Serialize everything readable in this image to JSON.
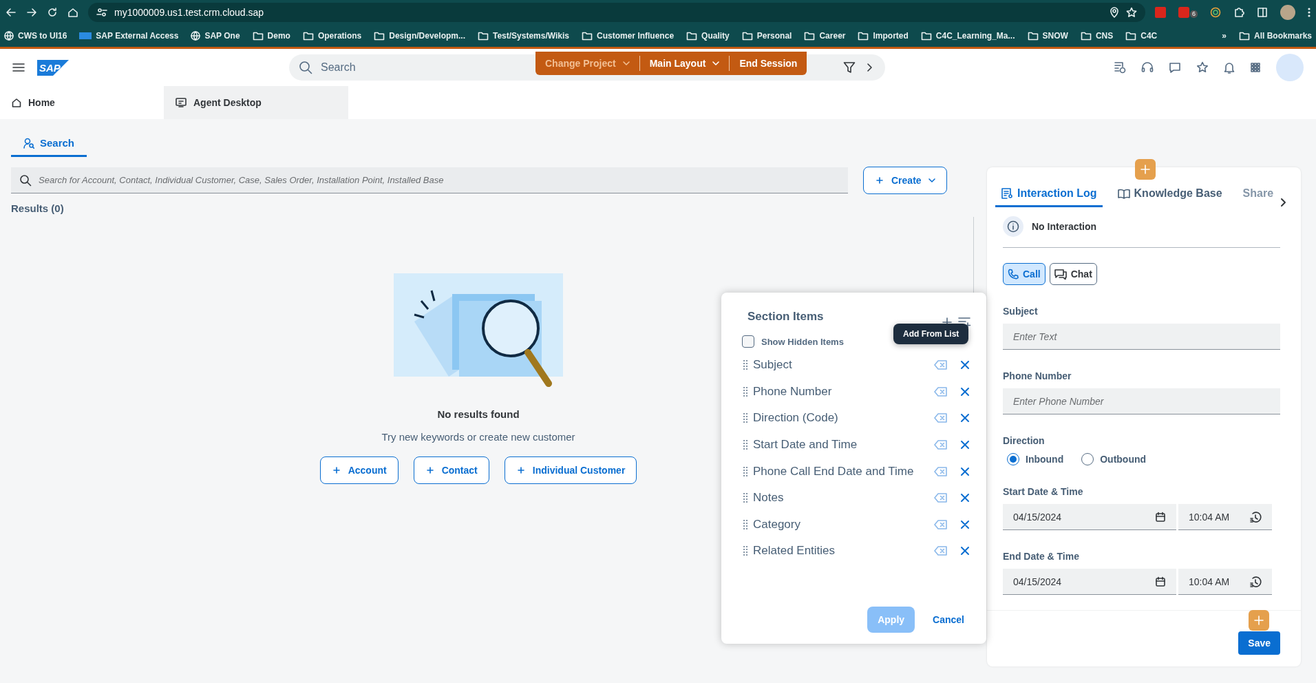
{
  "browser": {
    "url": "my1000009.us1.test.crm.cloud.sap",
    "extension_badge": "6",
    "bookmarks": [
      {
        "label": "CWS to UI16",
        "kind": "site"
      },
      {
        "label": "SAP External Access",
        "kind": "sap"
      },
      {
        "label": "SAP One",
        "kind": "site"
      },
      {
        "label": "Demo",
        "kind": "folder"
      },
      {
        "label": "Operations",
        "kind": "folder"
      },
      {
        "label": "Design/Developm...",
        "kind": "folder"
      },
      {
        "label": "Test/Systems/Wikis",
        "kind": "folder"
      },
      {
        "label": "Customer Influence",
        "kind": "folder"
      },
      {
        "label": "Quality",
        "kind": "folder"
      },
      {
        "label": "Personal",
        "kind": "folder"
      },
      {
        "label": "Career",
        "kind": "folder"
      },
      {
        "label": "Imported",
        "kind": "folder"
      },
      {
        "label": "C4C_Learning_Ma...",
        "kind": "folder"
      },
      {
        "label": "SNOW",
        "kind": "folder"
      },
      {
        "label": "CNS",
        "kind": "folder"
      },
      {
        "label": "C4C",
        "kind": "folder"
      }
    ],
    "more": "»",
    "all_bookmarks": "All Bookmarks"
  },
  "app_header": {
    "logo": "SAP",
    "search_placeholder": "Search",
    "actions": [
      {
        "label": "Change Project",
        "dropdown": true,
        "disabled": true
      },
      {
        "label": "Main Layout",
        "dropdown": true,
        "disabled": false
      },
      {
        "label": "End Session",
        "dropdown": false,
        "disabled": false
      }
    ]
  },
  "workspace_tabs": [
    {
      "label": "Home",
      "selected": false
    },
    {
      "label": "Agent Desktop",
      "selected": true
    }
  ],
  "search_pane": {
    "tab": {
      "label": "Search",
      "selected": true
    },
    "placeholder": "Search for Account, Contact, Individual Customer, Case, Sales Order, Installation Point, Installed Base",
    "create_button": "Create",
    "results": "Results (0)",
    "empty_title": "No results found",
    "empty_message": "Try new keywords or create new customer",
    "create_buttons": [
      "Account",
      "Contact",
      "Individual Customer"
    ]
  },
  "section_items": {
    "title": "Section Items",
    "tooltip": "Add From List",
    "show_hidden": {
      "label": "Show Hidden Items",
      "checked": false
    },
    "items": [
      "Subject",
      "Phone Number",
      "Direction (Code)",
      "Start Date and Time",
      "Phone Call End Date and Time",
      "Notes",
      "Category",
      "Related Entities"
    ],
    "apply": {
      "label": "Apply",
      "disabled": true
    },
    "cancel": "Cancel"
  },
  "interaction_panel": {
    "tabs": [
      {
        "label": "Interaction Log",
        "selected": true
      },
      {
        "label": "Knowledge Base",
        "selected": false
      },
      {
        "label": "Share",
        "selected": false
      }
    ],
    "status": "No Interaction",
    "channels": [
      {
        "label": "Call",
        "selected": true
      },
      {
        "label": "Chat",
        "selected": false
      }
    ],
    "subject": {
      "label": "Subject",
      "placeholder": "Enter Text"
    },
    "phone": {
      "label": "Phone Number",
      "placeholder": "Enter Phone Number"
    },
    "direction": {
      "label": "Direction",
      "options": [
        {
          "label": "Inbound",
          "selected": true
        },
        {
          "label": "Outbound",
          "selected": false
        }
      ]
    },
    "start": {
      "label": "Start Date & Time",
      "date": "04/15/2024",
      "time": "10:04 AM"
    },
    "end": {
      "label": "End Date & Time",
      "date": "04/15/2024",
      "time": "10:04 AM"
    },
    "save": "Save"
  }
}
